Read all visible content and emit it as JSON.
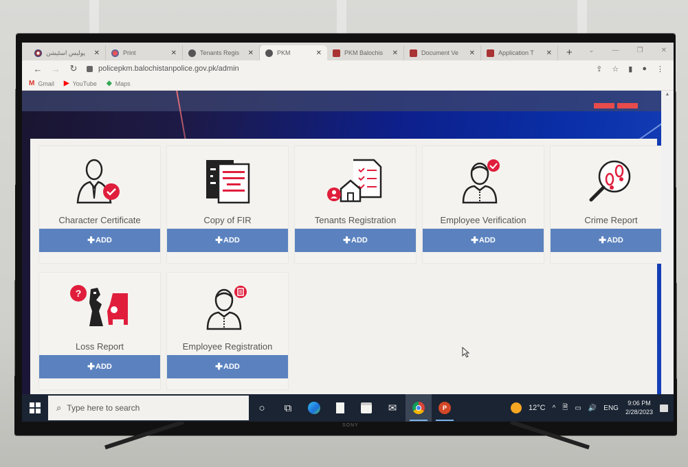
{
  "browser": {
    "tabs": [
      {
        "title": "پولیس اسٹیشن",
        "favicon": "police-logo",
        "active": false
      },
      {
        "title": "Print",
        "favicon": "police-logo",
        "active": false
      },
      {
        "title": "Tenants Regis",
        "favicon": "globe",
        "active": false
      },
      {
        "title": "PKM",
        "favicon": "globe",
        "active": true
      },
      {
        "title": "PKM Balochis",
        "favicon": "shield",
        "active": false
      },
      {
        "title": "Document Ve",
        "favicon": "shield",
        "active": false
      },
      {
        "title": "Application T",
        "favicon": "shield",
        "active": false
      }
    ],
    "new_tab_label": "+",
    "url": "policepkm.balochistanpolice.gov.pk/admin",
    "bookmarks": [
      {
        "label": "Gmail",
        "icon": "gmail-icon",
        "color": "#d93025"
      },
      {
        "label": "YouTube",
        "icon": "youtube-icon",
        "color": "#ff0000"
      },
      {
        "label": "Maps",
        "icon": "maps-icon",
        "color": "#34a853"
      }
    ]
  },
  "dashboard": {
    "accent": "#e63946",
    "button_color": "#5b82bf",
    "cards": [
      {
        "label": "Character Certificate",
        "icon": "certified-person-icon",
        "button": "ADD"
      },
      {
        "label": "Copy of FIR",
        "icon": "document-copy-icon",
        "button": "ADD"
      },
      {
        "label": "Tenants Registration",
        "icon": "tenant-house-checklist-icon",
        "button": "ADD"
      },
      {
        "label": "Employee Verification",
        "icon": "verified-employee-icon",
        "button": "ADD"
      },
      {
        "label": "Crime Report",
        "icon": "footprint-magnifier-icon",
        "button": "ADD"
      },
      {
        "label": "Loss Report",
        "icon": "lost-item-car-icon",
        "button": "ADD"
      },
      {
        "label": "Employee Registration",
        "icon": "employee-document-icon",
        "button": "ADD"
      }
    ]
  },
  "taskbar": {
    "search_placeholder": "Type here to search",
    "weather": "12°C",
    "language": "ENG",
    "time": "9:06 PM",
    "date": "2/28/2023"
  },
  "tv_brand": "SONY"
}
